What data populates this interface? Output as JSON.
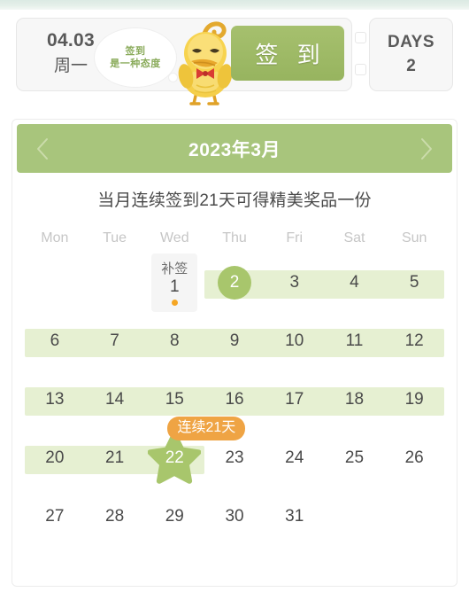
{
  "ticket": {
    "date": "04.03",
    "weekday": "周一",
    "bubble_line1": "签到",
    "bubble_line2": "是一种态度",
    "signin_button": "签 到",
    "days_label": "DAYS",
    "days_value": "2",
    "mascot_icon": "duck-mascot-icon"
  },
  "calendar": {
    "title": "2023年3月",
    "prev_icon": "chevron-left-icon",
    "next_icon": "chevron-right-icon",
    "subtitle": "当月连续签到21天可得精美奖品一份",
    "weekdays": [
      "Mon",
      "Tue",
      "Wed",
      "Thu",
      "Fri",
      "Sat",
      "Sun"
    ],
    "streak_badge": "连续21天",
    "makeup_label": "补签",
    "weeks": [
      [
        {
          "day": ""
        },
        {
          "day": ""
        },
        {
          "day": "1",
          "state": "makeup"
        },
        {
          "day": "2",
          "state": "circle"
        },
        {
          "day": "3",
          "state": "banded"
        },
        {
          "day": "4",
          "state": "banded"
        },
        {
          "day": "5",
          "state": "banded"
        }
      ],
      [
        {
          "day": "6",
          "state": "banded"
        },
        {
          "day": "7",
          "state": "banded"
        },
        {
          "day": "8",
          "state": "banded"
        },
        {
          "day": "9",
          "state": "banded"
        },
        {
          "day": "10",
          "state": "banded"
        },
        {
          "day": "11",
          "state": "banded"
        },
        {
          "day": "12",
          "state": "banded"
        }
      ],
      [
        {
          "day": "13",
          "state": "banded"
        },
        {
          "day": "14",
          "state": "banded"
        },
        {
          "day": "15",
          "state": "banded"
        },
        {
          "day": "16",
          "state": "banded"
        },
        {
          "day": "17",
          "state": "banded"
        },
        {
          "day": "18",
          "state": "banded"
        },
        {
          "day": "19",
          "state": "banded"
        }
      ],
      [
        {
          "day": "20",
          "state": "banded"
        },
        {
          "day": "21",
          "state": "banded"
        },
        {
          "day": "22",
          "state": "star"
        },
        {
          "day": "23"
        },
        {
          "day": "24"
        },
        {
          "day": "25"
        },
        {
          "day": "26"
        }
      ],
      [
        {
          "day": "27"
        },
        {
          "day": "28"
        },
        {
          "day": "29"
        },
        {
          "day": "30"
        },
        {
          "day": "31"
        },
        {
          "day": ""
        },
        {
          "day": ""
        }
      ]
    ],
    "bands": [
      {
        "row": 0,
        "start": 3,
        "end": 6
      },
      {
        "row": 1,
        "start": 0,
        "end": 6
      },
      {
        "row": 2,
        "start": 0,
        "end": 6
      },
      {
        "row": 3,
        "start": 0,
        "end": 2
      }
    ]
  },
  "colors": {
    "header_green": "#a8c57c",
    "band_green": "#e6f0d2",
    "mark_green": "#a8c66c",
    "badge_orange": "#efa444",
    "dot_orange": "#f5a623"
  }
}
